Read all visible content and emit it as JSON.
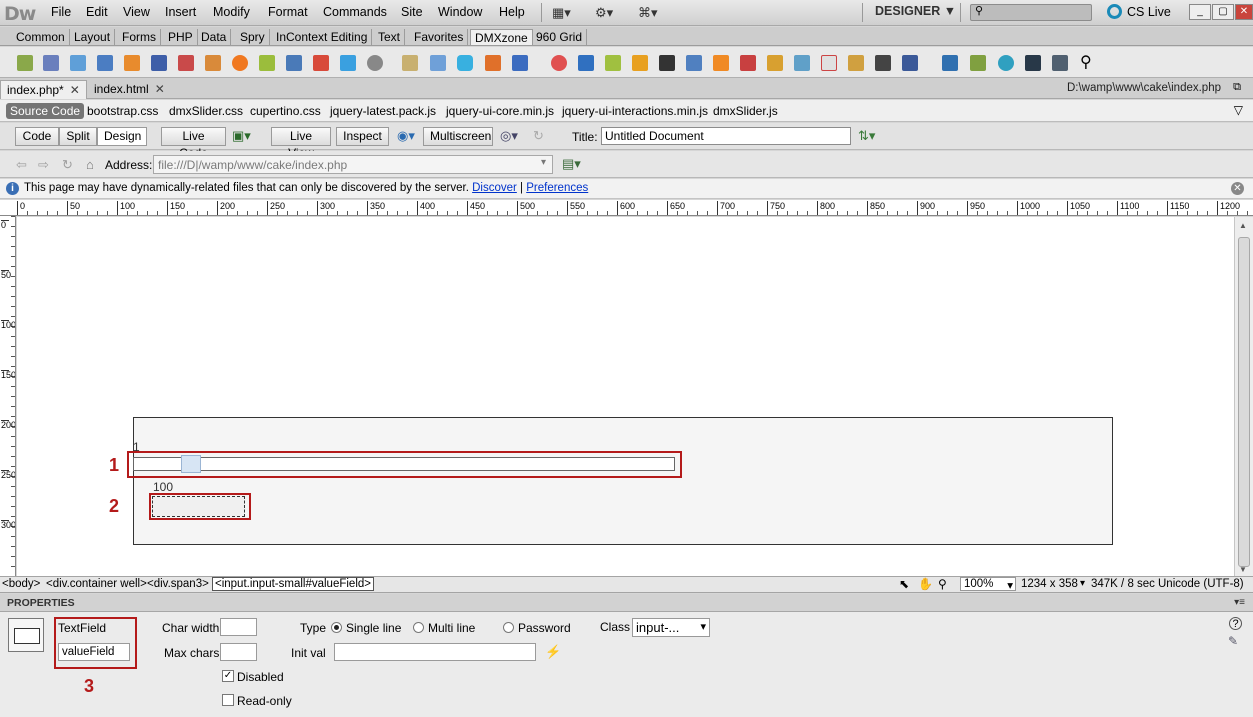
{
  "app": {
    "logo": "Dw",
    "menu": [
      "File",
      "Edit",
      "View",
      "Insert",
      "Modify",
      "Format",
      "Commands",
      "Site",
      "Window",
      "Help"
    ],
    "workspace": "DESIGNER ▼",
    "cs_live": "CS Live",
    "window_controls": [
      "_",
      "▢",
      "✕"
    ]
  },
  "insert_tabs": [
    "Common",
    "Layout",
    "Forms",
    "PHP",
    "Data",
    "Spry",
    "InContext Editing",
    "Text",
    "Favorites",
    "DMXzone",
    "960 Grid"
  ],
  "insert_active": "DMXzone",
  "document": {
    "tabs": [
      {
        "label": "index.php*",
        "close": "✕"
      },
      {
        "label": "index.html",
        "close": "✕"
      }
    ],
    "path": "D:\\wamp\\www\\cake\\index.php"
  },
  "related_files": [
    "Source Code",
    "bootstrap.css",
    "dmxSlider.css",
    "cupertino.css",
    "jquery-latest.pack.js",
    "jquery-ui-core.min.js",
    "jquery-ui-interactions.min.js",
    "dmxSlider.js"
  ],
  "doc_toolbar": {
    "code": "Code",
    "split": "Split",
    "design": "Design",
    "live_code": "Live Code",
    "live_view": "Live View",
    "inspect": "Inspect",
    "multiscreen": "Multiscreen",
    "title_label": "Title:",
    "title_value": "Untitled Document"
  },
  "address_bar": {
    "label": "Address:",
    "value": "file:///D|/wamp/www/cake/index.php"
  },
  "info_bar": {
    "message": "This page may have dynamically-related files that can only be discovered by the server.",
    "discover": "Discover",
    "preferences": "Preferences"
  },
  "ruler": {
    "h_ticks": [
      "0",
      "50",
      "100",
      "150",
      "200",
      "250",
      "300",
      "350",
      "400",
      "450",
      "500",
      "550",
      "600",
      "650",
      "700",
      "750",
      "800",
      "850",
      "900",
      "950",
      "1000",
      "1050",
      "1100",
      "1150",
      "1200"
    ],
    "v_ticks": [
      "0",
      "50",
      "100",
      "150",
      "200",
      "250",
      "300"
    ]
  },
  "canvas": {
    "slider_min_label": "1",
    "slider_max_label": "100",
    "slider_value": 10,
    "slider_min": 1,
    "slider_max": 100
  },
  "callouts": [
    "1",
    "2",
    "3"
  ],
  "status_bar": {
    "tags": [
      "<body>",
      "<div.container well>",
      "<div.span3>",
      "<input.input-small#valueField>"
    ],
    "zoom": "100%",
    "window_size": "1234 x 358",
    "file_info": "347K / 8 sec",
    "encoding": "Unicode (UTF-8)"
  },
  "properties": {
    "header": "PROPERTIES",
    "element_type": "TextField",
    "element_id": "valueField",
    "char_width_label": "Char width",
    "max_chars_label": "Max chars",
    "type_label": "Type",
    "type_options": [
      "Single line",
      "Multi line",
      "Password"
    ],
    "type_selected": "Single line",
    "init_val_label": "Init val",
    "class_label": "Class",
    "class_value": "input-...",
    "disabled_label": "Disabled",
    "disabled_checked": true,
    "readonly_label": "Read-only",
    "readonly_checked": false
  },
  "colors": {
    "callout": "#b41a1a",
    "link": "#0033cc",
    "slider_handle": "#d7e5f4"
  }
}
